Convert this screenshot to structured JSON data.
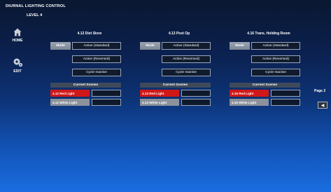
{
  "app": {
    "title": "DIURNAL LIGHTING CONTROL",
    "subtitle": "LEVEL 4"
  },
  "nav": {
    "home": {
      "label": "HOME",
      "icon": "house-icon"
    },
    "edit": {
      "label": "EDIT",
      "icon": "gears-icon"
    }
  },
  "zones": [
    {
      "title": "4.12 Diet Store",
      "mode_label": "Mode",
      "mode_value": "Active (Standard)",
      "reversed_label": "Active (Reversed)",
      "cycle_label": "Cycle Inactive",
      "scenes_header": "Current Scenes",
      "scenes": [
        {
          "name": "4.12 Red Light",
          "value": ""
        },
        {
          "name": "4.12 White Light",
          "value": ""
        }
      ]
    },
    {
      "title": "4.13 Post Op",
      "mode_label": "Mode",
      "mode_value": "Active (Standard)",
      "reversed_label": "Active (Reversed)",
      "cycle_label": "Cycle Inactive",
      "scenes_header": "Current Scenes",
      "scenes": [
        {
          "name": "4.13 Red Light",
          "value": ""
        },
        {
          "name": "4.13 White Light",
          "value": ""
        }
      ]
    },
    {
      "title": "4.16 Trans. Holding Room",
      "mode_label": "Mode",
      "mode_value": "Active (Standard)",
      "reversed_label": "Active (Reversed)",
      "cycle_label": "Cycle Inactive",
      "scenes_header": "Current Scenes",
      "scenes": [
        {
          "name": "4.16 Red Light",
          "value": ""
        },
        {
          "name": "4.16 White Light",
          "value": ""
        }
      ]
    }
  ],
  "paging": {
    "label": "Page 2",
    "back_icon": "arrow-left-icon"
  },
  "colors": {
    "red_scene": "#d01818",
    "white_scene": "#8c929c",
    "mode": "#8e97a6"
  }
}
